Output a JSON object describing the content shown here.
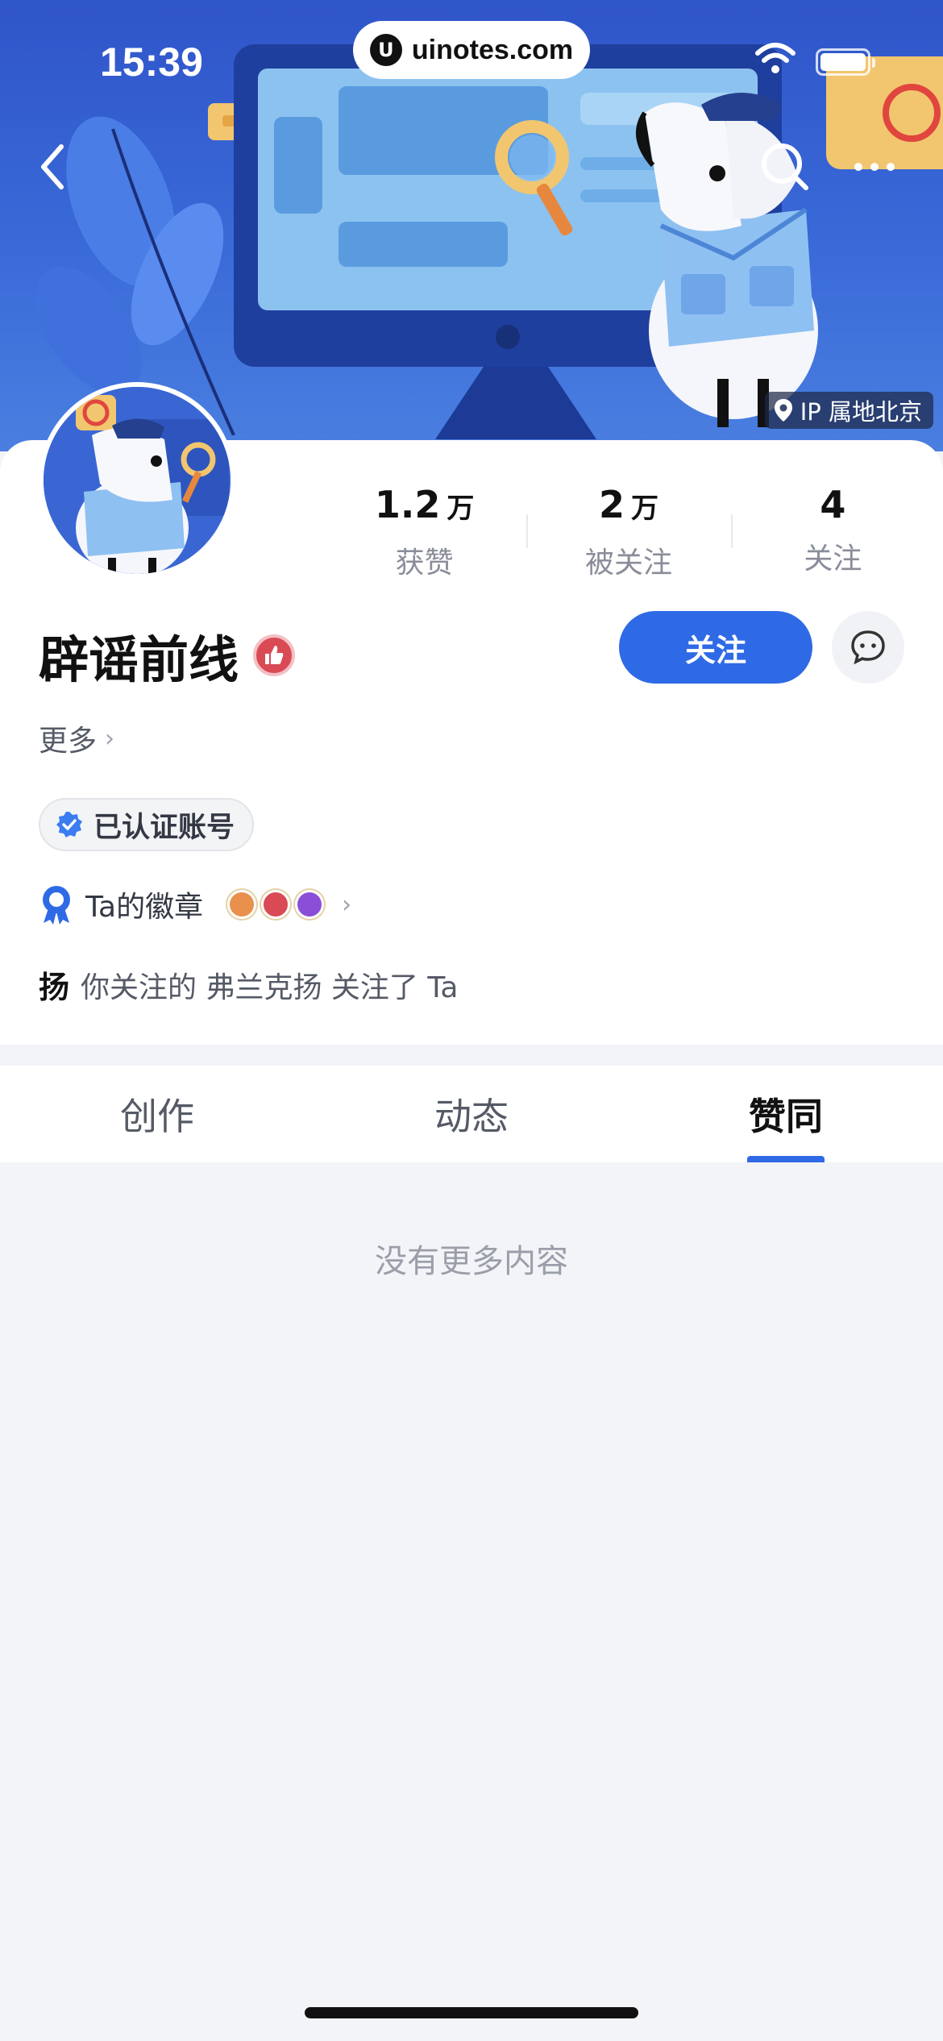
{
  "status_bar": {
    "time": "15:39",
    "url": "uinotes.com"
  },
  "header": {
    "ip_location": "IP 属地北京"
  },
  "profile": {
    "name": "辟谣前线",
    "stats": [
      {
        "value": "1.2",
        "unit": "万",
        "label": "获赞"
      },
      {
        "value": "2",
        "unit": "万",
        "label": "被关注"
      },
      {
        "value": "4",
        "unit": "",
        "label": "关注"
      }
    ],
    "follow_label": "关注",
    "more_label": "更多",
    "verified_label": "已认证账号",
    "badges_label": "Ta的徽章",
    "mutual_avatar_char": "扬",
    "mutual_text": "你关注的 弗兰克扬 关注了 Ta"
  },
  "tabs": [
    {
      "label": "创作",
      "active": false
    },
    {
      "label": "动态",
      "active": false
    },
    {
      "label": "赞同",
      "active": true
    }
  ],
  "content": {
    "empty_text": "没有更多内容"
  },
  "colors": {
    "accent": "#2f6ae6",
    "banner": "#2f55c9",
    "page_bg": "#f3f4f8"
  },
  "icons": [
    "back-icon",
    "search-icon",
    "more-icon",
    "location-icon",
    "thumbs-up-badge-icon",
    "chat-icon",
    "verified-check-icon",
    "medal-icon",
    "chevron-right-icon"
  ]
}
